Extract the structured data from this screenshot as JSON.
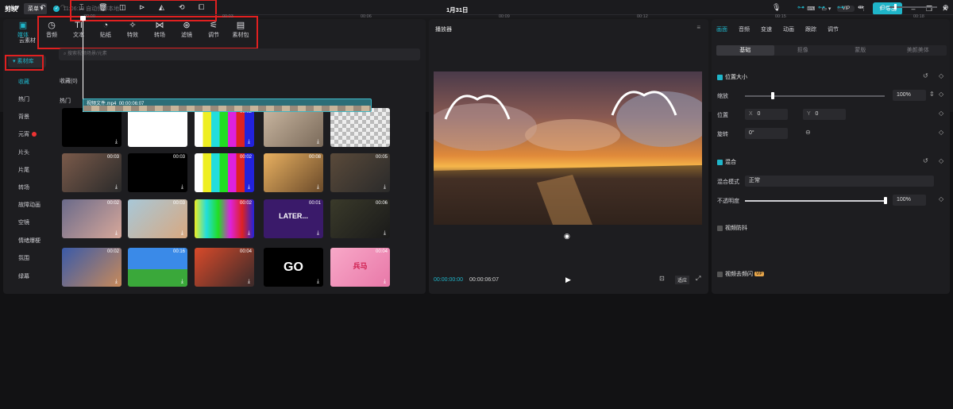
{
  "titlebar": {
    "app": "剪映",
    "menu": "菜单",
    "save_status": "11:06:13 自动保存本地",
    "doc_title": "1月31日",
    "vip": "VIP",
    "export": "导出"
  },
  "tools": {
    "media": "媒体",
    "audio": "音频",
    "text": "文本",
    "sticker": "贴纸",
    "effects": "特效",
    "transitions": "转场",
    "filters": "滤镜",
    "adjust": "调节",
    "pack": "素材包"
  },
  "sidebar": {
    "cloud": "云素材",
    "library": "素材库",
    "items": [
      "收藏",
      "热门",
      "背景",
      "元宵",
      "片头",
      "片尾",
      "转场",
      "故障动画",
      "空镜",
      "情绪爆梗",
      "氛围",
      "绿幕"
    ]
  },
  "media": {
    "search_placeholder": "搜索视频场景/元素",
    "favorites": "收藏(0)",
    "hot": "热门",
    "thumbs": [
      {
        "dur": ""
      },
      {
        "dur": ""
      },
      {
        "dur": "00:02"
      },
      {
        "dur": ""
      },
      {
        "dur": ""
      },
      {
        "dur": "00:03"
      },
      {
        "dur": "00:03"
      },
      {
        "dur": "00:02"
      },
      {
        "dur": "00:08"
      },
      {
        "dur": "00:05"
      },
      {
        "dur": "00:02"
      },
      {
        "dur": "00:03"
      },
      {
        "dur": "00:02"
      },
      {
        "dur": "00:01"
      },
      {
        "dur": "00:06"
      },
      {
        "dur": "00:02"
      },
      {
        "dur": "00:16"
      },
      {
        "dur": "00:04"
      },
      {
        "dur": ""
      },
      {
        "dur": "00:04"
      }
    ],
    "text_tile_a": "LATER...",
    "text_tile_b": "GO",
    "text_tile_c": "兵马"
  },
  "player": {
    "title": "播放器",
    "current": "00:00:00:00",
    "total": "00:00:06:07",
    "ratio": "适应"
  },
  "props": {
    "tabs": [
      "画面",
      "音频",
      "变速",
      "动画",
      "跟踪",
      "调节"
    ],
    "subtabs": [
      "基础",
      "抠像",
      "蒙版",
      "美颜美体"
    ],
    "position_size": "位置大小",
    "scale": "缩放",
    "scale_val": "100%",
    "position": "位置",
    "x_label": "X",
    "x_val": "0",
    "y_label": "Y",
    "y_val": "0",
    "rotate": "旋转",
    "rotate_val": "0°",
    "blend": "混合",
    "blend_mode": "混合模式",
    "blend_val": "正常",
    "opacity": "不透明度",
    "opacity_val": "100%",
    "stabilize": "视频防抖",
    "deflicker": "视频去频闪",
    "vip_badge": "VIP"
  },
  "timeline": {
    "ticks": [
      "00:00",
      "00:03",
      "00:06",
      "00:09",
      "00:12",
      "00:15",
      "00:18"
    ],
    "clip_name": "视频文件.mp4",
    "clip_duration": "00:00:06:07"
  },
  "colors": {
    "accent": "#1fb5c9",
    "highlight": "#e02020"
  }
}
